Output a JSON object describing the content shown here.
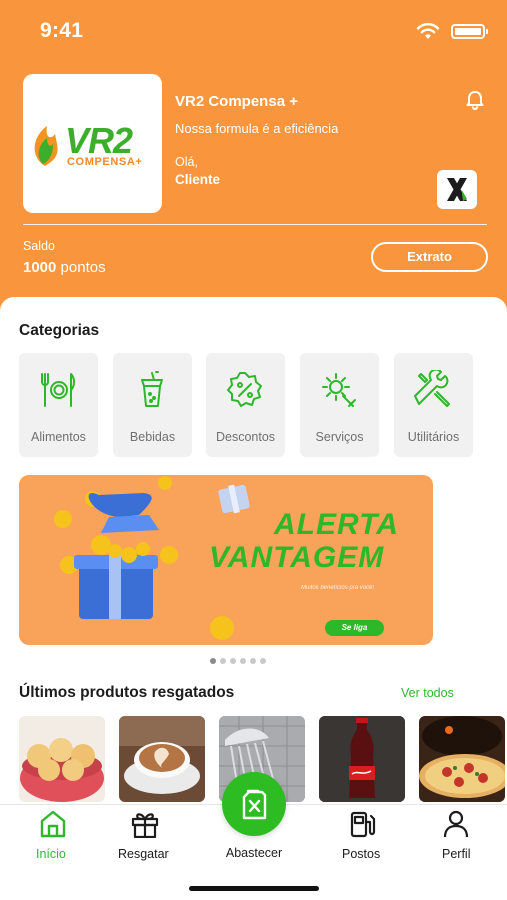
{
  "status_bar": {
    "time": "9:41",
    "icons": [
      "wifi-icon",
      "battery-icon"
    ]
  },
  "header": {
    "logo": {
      "text": "VR2",
      "subtext": "COMPENSA+"
    },
    "company_name": "VR2 Compensa +",
    "slogan": "Nossa formula é a eficiência",
    "greeting": "Olá,",
    "user_name": "Cliente",
    "icons": [
      "bell-icon",
      "x-brand-icon"
    ],
    "balance_label": "Saldo",
    "balance_amount": "1000",
    "balance_unit": " pontos",
    "statement_button": "Extrato"
  },
  "categories": {
    "title": "Categorias",
    "items": [
      {
        "label": "Alimentos",
        "icon": "utensils-icon"
      },
      {
        "label": "Bebidas",
        "icon": "drink-cup-icon"
      },
      {
        "label": "Descontos",
        "icon": "discount-badge-icon"
      },
      {
        "label": "Serviços",
        "icon": "gear-wrench-icon"
      },
      {
        "label": "Utilitários",
        "icon": "tools-icon"
      }
    ]
  },
  "banner": {
    "line1": "ALERTA",
    "line2": "VANTAGEM",
    "subtitle": "Muitos benefícios pra você!",
    "cta": "Se liga",
    "pagination": {
      "total": 6,
      "active": 1
    }
  },
  "recent_products": {
    "title": "Últimos produtos resgatados",
    "see_all": "Ver todos",
    "items": [
      "cheese-bread",
      "cappuccino",
      "shower",
      "coca-cola",
      "pizza"
    ]
  },
  "tabbar": {
    "tabs": [
      {
        "label": "Início",
        "icon": "home-icon",
        "active": true
      },
      {
        "label": "Resgatar",
        "icon": "gift-icon",
        "active": false
      },
      {
        "label": "Abastecer",
        "icon": "fuel-can-icon",
        "active": false
      },
      {
        "label": "Postos",
        "icon": "gas-station-icon",
        "active": false
      },
      {
        "label": "Perfil",
        "icon": "user-icon",
        "active": false
      }
    ]
  },
  "colors": {
    "brand_orange": "#f9963d",
    "accent_green": "#2db82a",
    "card_gray": "#f1f1f1"
  }
}
